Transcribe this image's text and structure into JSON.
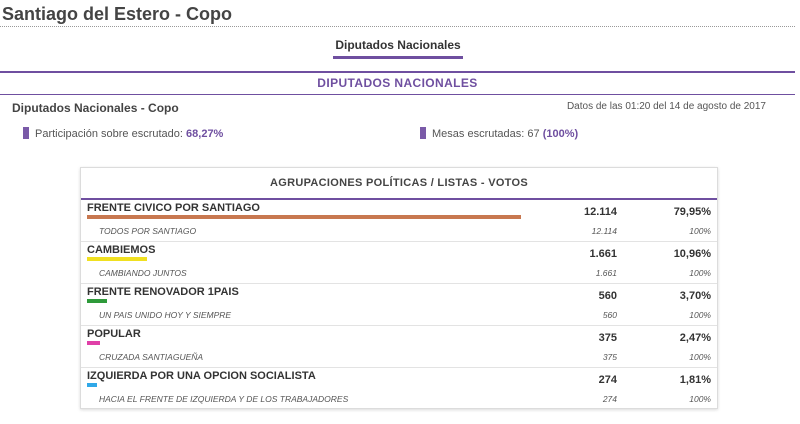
{
  "page": {
    "title": "Santiago del Estero - Copo"
  },
  "tabs": [
    {
      "label": "Diputados Nacionales",
      "active": true
    }
  ],
  "section": {
    "heading": "DIPUTADOS NACIONALES",
    "subtitle": "Diputados Nacionales - Copo",
    "timestamp": "Datos de las 01:20 del 14 de agosto de 2017"
  },
  "stats": {
    "participation": {
      "label": "Participación sobre escrutado:",
      "value": "68,27%"
    },
    "tables": {
      "label": "Mesas escrutadas:",
      "count": "67",
      "percent": "(100%)"
    }
  },
  "results": {
    "header": "AGRUPACIONES POLÍTICAS / LISTAS - VOTOS",
    "parties": [
      {
        "name": "FRENTE CIVICO POR SANTIAGO",
        "votes": "12.114",
        "pct": "79,95%",
        "share": 0.7995,
        "color": "#c87850",
        "list": {
          "name": "TODOS POR SANTIAGO",
          "votes": "12.114",
          "pct": "100%"
        }
      },
      {
        "name": "CAMBIEMOS",
        "votes": "1.661",
        "pct": "10,96%",
        "share": 0.1096,
        "color": "#f0e020",
        "list": {
          "name": "CAMBIANDO JUNTOS",
          "votes": "1.661",
          "pct": "100%"
        }
      },
      {
        "name": "FRENTE RENOVADOR 1PAIS",
        "votes": "560",
        "pct": "3,70%",
        "share": 0.037,
        "color": "#2e9a3a",
        "list": {
          "name": "UN PAIS UNIDO HOY Y SIEMPRE",
          "votes": "560",
          "pct": "100%"
        }
      },
      {
        "name": "POPULAR",
        "votes": "375",
        "pct": "2,47%",
        "share": 0.0247,
        "color": "#e040a8",
        "list": {
          "name": "CRUZADA SANTIAGUEÑA",
          "votes": "375",
          "pct": "100%"
        }
      },
      {
        "name": "IZQUIERDA POR UNA OPCION SOCIALISTA",
        "votes": "274",
        "pct": "1,81%",
        "share": 0.0181,
        "color": "#30a8e8",
        "list": {
          "name": "HACIA EL FRENTE DE IZQUIERDA Y DE LOS TRABAJADORES",
          "votes": "274",
          "pct": "100%"
        }
      }
    ]
  }
}
